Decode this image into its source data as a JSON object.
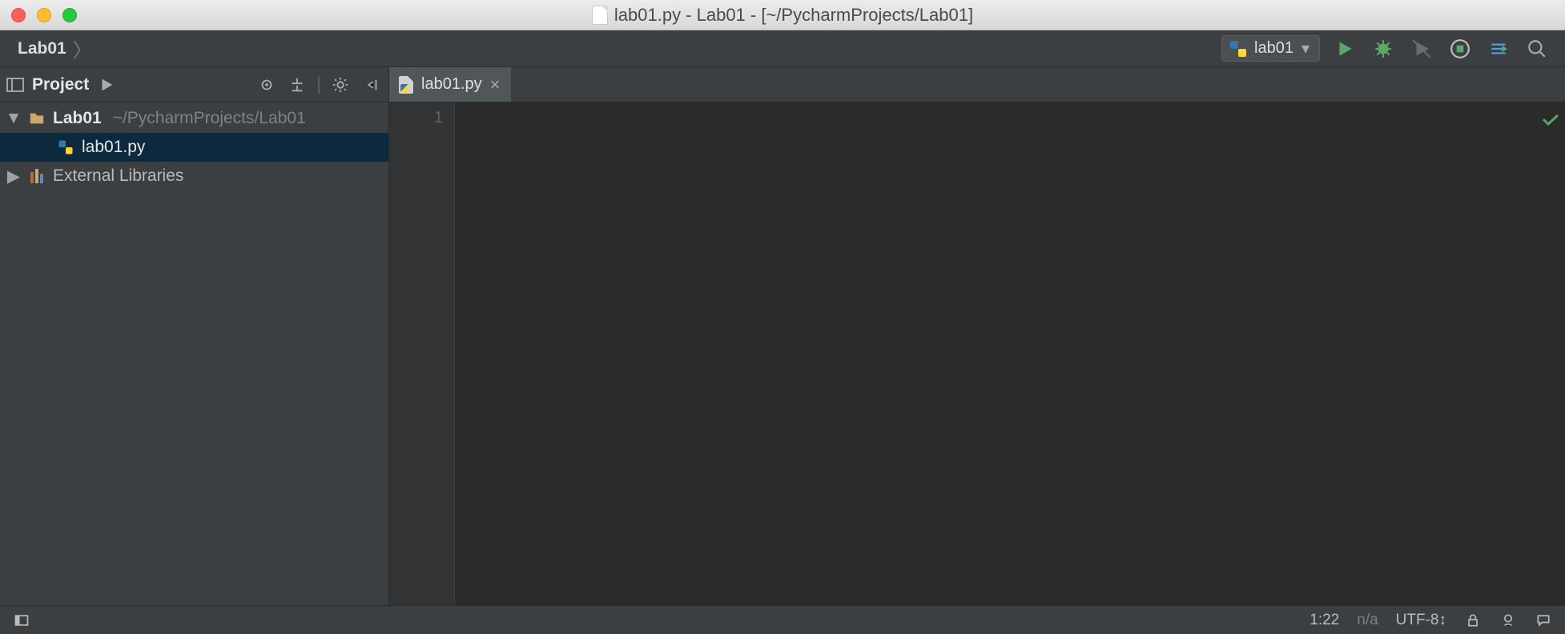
{
  "window": {
    "title": "lab01.py - Lab01 - [~/PycharmProjects/Lab01]"
  },
  "breadcrumb": {
    "root": "Lab01"
  },
  "run": {
    "config_label": "lab01"
  },
  "project_panel": {
    "title": "Project",
    "root_name": "Lab01",
    "root_path": "~/PycharmProjects/Lab01",
    "file_name": "lab01.py",
    "external_label": "External Libraries"
  },
  "editor": {
    "tab_label": "lab01.py",
    "gutter_line": "1"
  },
  "status": {
    "position": "1:22",
    "context": "n/a",
    "encoding": "UTF-8",
    "encoding_suffix": "↕"
  }
}
